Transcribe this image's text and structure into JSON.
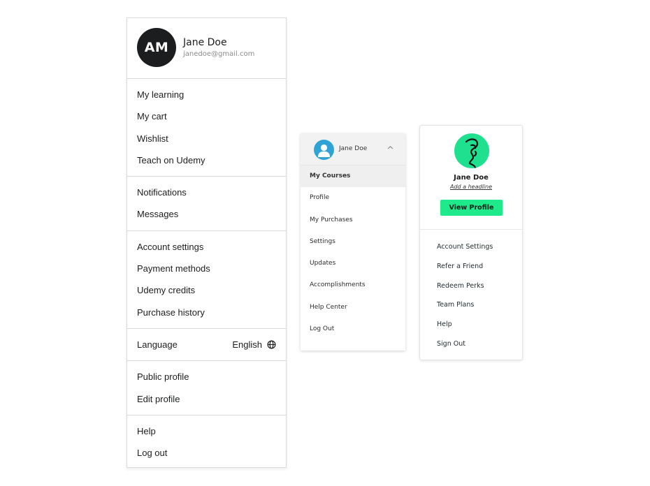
{
  "menu1": {
    "avatar_initials": "AM",
    "name": "Jane Doe",
    "email": "janedoe@gmail.com",
    "sections": [
      {
        "items": [
          {
            "label": "My learning"
          },
          {
            "label": "My cart"
          },
          {
            "label": "Wishlist"
          },
          {
            "label": "Teach on Udemy"
          }
        ]
      },
      {
        "items": [
          {
            "label": "Notifications"
          },
          {
            "label": "Messages"
          }
        ]
      },
      {
        "items": [
          {
            "label": "Account settings"
          },
          {
            "label": "Payment methods"
          },
          {
            "label": "Udemy credits"
          },
          {
            "label": "Purchase history"
          }
        ]
      },
      {
        "items": [
          {
            "label": "Language",
            "value": "English",
            "icon": "globe-icon"
          }
        ]
      },
      {
        "items": [
          {
            "label": "Public profile"
          },
          {
            "label": "Edit profile"
          }
        ]
      },
      {
        "items": [
          {
            "label": "Help"
          },
          {
            "label": "Log out"
          }
        ]
      }
    ]
  },
  "menu2": {
    "name": "Jane Doe",
    "avatar_icon": "user-icon",
    "avatar_color": "#2fa3d6",
    "chevron_icon": "chevron-up-icon",
    "items": [
      {
        "label": "My Courses",
        "active": true
      },
      {
        "label": "Profile"
      },
      {
        "label": "My Purchases"
      },
      {
        "label": "Settings"
      },
      {
        "label": "Updates"
      },
      {
        "label": "Accomplishments"
      },
      {
        "label": "Help Center"
      },
      {
        "label": "Log Out"
      }
    ]
  },
  "menu3": {
    "name": "Jane Doe",
    "headline_link": "Add a headline",
    "button_label": "View Profile",
    "accent_color": "#1eea8c",
    "avatar_icon": "face-line-art-icon",
    "items": [
      {
        "label": "Account Settings"
      },
      {
        "label": "Refer a Friend"
      },
      {
        "label": "Redeem Perks"
      },
      {
        "label": "Team Plans"
      },
      {
        "label": "Help"
      },
      {
        "label": "Sign Out"
      }
    ]
  }
}
